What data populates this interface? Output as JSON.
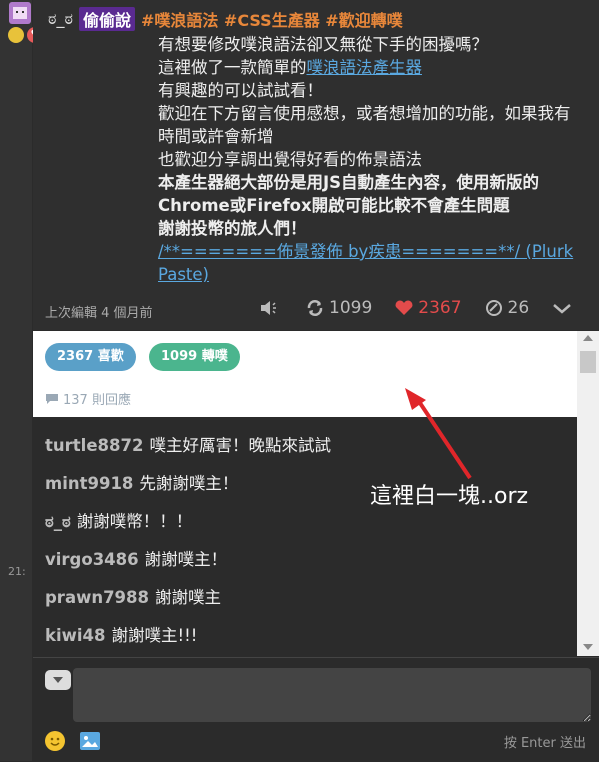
{
  "post": {
    "user": "ಠ_ಠ",
    "qualifier": "偷偷說",
    "tags": "#噗浪語法 #CSS生產器 #歡迎轉噗",
    "lines": [
      "有想要修改噗浪語法卻又無從下手的困擾嗎？",
      "這裡做了一款簡單的",
      "噗浪語法產生器",
      "有興趣的可以試試看！",
      "歡迎在下方留言使用感想，或者想增加的功能，如果我有時間或許會新增",
      "也歡迎分享調出覺得好看的佈景語法",
      "本產生器絕大部份是用JS自動產生內容，使用新版的Chrome或Firefox開啟可能比較不會產生問題",
      "謝謝投幣的旅人們！",
      "/**=======佈景發佈 by疾患=======**/ (Plurk Paste)"
    ],
    "edited": "上次編輯 4 個月前",
    "replurk_count": "1099",
    "love_count": "2367",
    "response_count": "26"
  },
  "stats": {
    "likes_label": "2367 喜歡",
    "replurks_label": "1099 轉噗",
    "responses_label": "137 則回應"
  },
  "responses": [
    {
      "user": "turtle8872",
      "text": "噗主好厲害！晚點來試試"
    },
    {
      "user": "mint9918",
      "text": "先謝謝噗主！"
    },
    {
      "user": "ಠ_ಠ",
      "text": "謝謝噗幣！！！"
    },
    {
      "user": "virgo3486",
      "text": "謝謝噗主！"
    },
    {
      "user": "prawn7988",
      "text": "謝謝噗主"
    },
    {
      "user": "kiwi48",
      "text": "謝謝噗主!!!"
    }
  ],
  "annotation": "這裡白一塊..orz",
  "gutter_time": "21:",
  "input": {
    "send_hint": "按 Enter 送出"
  },
  "colors": {
    "accent_orange": "#e8873a",
    "qualifier_purple": "#5a2a91",
    "link_blue": "#5aa8e0",
    "love_red": "#e34b4b",
    "like_pill": "#5aa0c8",
    "replurk_pill": "#4bb58e",
    "annotation_red": "#e0262a"
  }
}
